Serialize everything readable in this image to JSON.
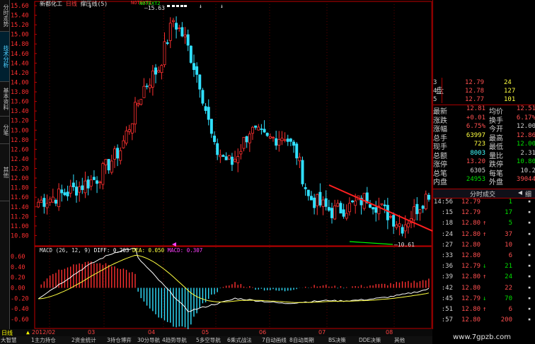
{
  "left_tabs": [
    "分时走势",
    "技术分析",
    "基本资料",
    "分笔",
    "其他"
  ],
  "chart_header": {
    "stock": "新都化工",
    "period": "日线",
    "indicator": "撑压线(5)",
    "notext1": "NOTEXT1",
    "notext2": "NOTEXT2",
    "max_label": "15.63",
    "min_label": "10.61"
  },
  "price_axis": [
    "15.60",
    "15.40",
    "15.20",
    "15.00",
    "14.80",
    "14.60",
    "14.40",
    "14.20",
    "14.00",
    "13.80",
    "13.60",
    "13.40",
    "13.20",
    "13.00",
    "12.80",
    "12.60",
    "12.40",
    "12.20",
    "12.00",
    "11.80",
    "11.60",
    "11.40",
    "11.20",
    "11.00",
    "10.80"
  ],
  "macd_header": {
    "name": "MACD (26, 12, 9)",
    "diff": "DIFF: 0.203",
    "dea": "DEA: 0.050",
    "macd": "MACD: 0.307"
  },
  "macd_axis": [
    "0.60",
    "0.40",
    "0.20",
    "0.00",
    "-0.20",
    "-0.40",
    "-0.60"
  ],
  "months": [
    "日线",
    "2012/02",
    "03",
    "04",
    "05",
    "06",
    "07",
    "08"
  ],
  "bottom_tabs": [
    "大智慧",
    "1主力持仓",
    "2资金统计",
    "3持仓博弈",
    "30分导航",
    "4趋势导航",
    "5多空导航",
    "6乘式战法",
    "7自动画线",
    "8自动周期",
    "BS决策",
    "DDE决策",
    "其他"
  ],
  "order_book": [
    {
      "n": "3",
      "price": "12.79",
      "vol": "24"
    },
    {
      "n": "4",
      "price": "12.78",
      "vol": "127"
    },
    {
      "n": "5",
      "price": "12.77",
      "vol": "101"
    }
  ],
  "order_book_side": "盘",
  "stats": [
    {
      "k1": "最新",
      "v1": "12.81",
      "k2": "均价",
      "v2": "12.51"
    },
    {
      "k1": "涨跌",
      "v1": "+0.01",
      "k2": "换手",
      "v2": "6.17%"
    },
    {
      "k1": "涨幅",
      "v1": "6.75%",
      "k2": "今开",
      "v2": "12.00"
    },
    {
      "k1": "总手",
      "v1": "63997",
      "k2": "最高",
      "v2": "12.86"
    },
    {
      "k1": "现手",
      "v1": "723",
      "k2": "最低",
      "v2": "12.00"
    },
    {
      "k1": "总额",
      "v1": "8003",
      "k2": "量比",
      "v2": "2.31"
    },
    {
      "k1": "涨停",
      "v1": "13.20",
      "k2": "跌停",
      "v2": "10.80"
    },
    {
      "k1": "总笔",
      "v1": "6305",
      "k2": "每笔",
      "v2": "10.2"
    },
    {
      "k1": "内盘",
      "v1": "24953",
      "k2": "外盘",
      "v2": "39044"
    }
  ],
  "ticks_header": "分时成交",
  "ticks_tab": "细",
  "ticks": [
    {
      "t": "14:56",
      "p": "12.79",
      "d": "",
      "v": "1",
      "c": "g"
    },
    {
      "t": ":15",
      "p": "12.79",
      "d": "",
      "v": "17",
      "c": "g"
    },
    {
      "t": ":18",
      "p": "12.80",
      "d": "↑",
      "v": "5",
      "c": "g"
    },
    {
      "t": ":24",
      "p": "12.80",
      "d": "↑",
      "v": "37",
      "c": "r"
    },
    {
      "t": ":27",
      "p": "12.80",
      "d": "",
      "v": "10",
      "c": "r"
    },
    {
      "t": ":33",
      "p": "12.80",
      "d": "",
      "v": "6",
      "c": "r"
    },
    {
      "t": ":36",
      "p": "12.79",
      "d": "↓",
      "v": "21",
      "c": "g"
    },
    {
      "t": ":39",
      "p": "12.80",
      "d": "↑",
      "v": "24",
      "c": "g"
    },
    {
      "t": ":42",
      "p": "12.80",
      "d": "",
      "v": "22",
      "c": "r"
    },
    {
      "t": ":45",
      "p": "12.79",
      "d": "↓",
      "v": "70",
      "c": "g"
    },
    {
      "t": ":51",
      "p": "12.80",
      "d": "↑",
      "v": "6",
      "c": "r"
    },
    {
      "t": ":57",
      "p": "12.80",
      "d": "",
      "v": "200",
      "c": "r"
    }
  ],
  "watermark": "www.7gpzb.com",
  "colors": {
    "up": "#ff3030",
    "down": "#30e0ff",
    "frame": "#c00000",
    "support": "#00ff00",
    "resist": "#ff2020",
    "diff": "#ffffff",
    "dea": "#ffff40"
  }
}
